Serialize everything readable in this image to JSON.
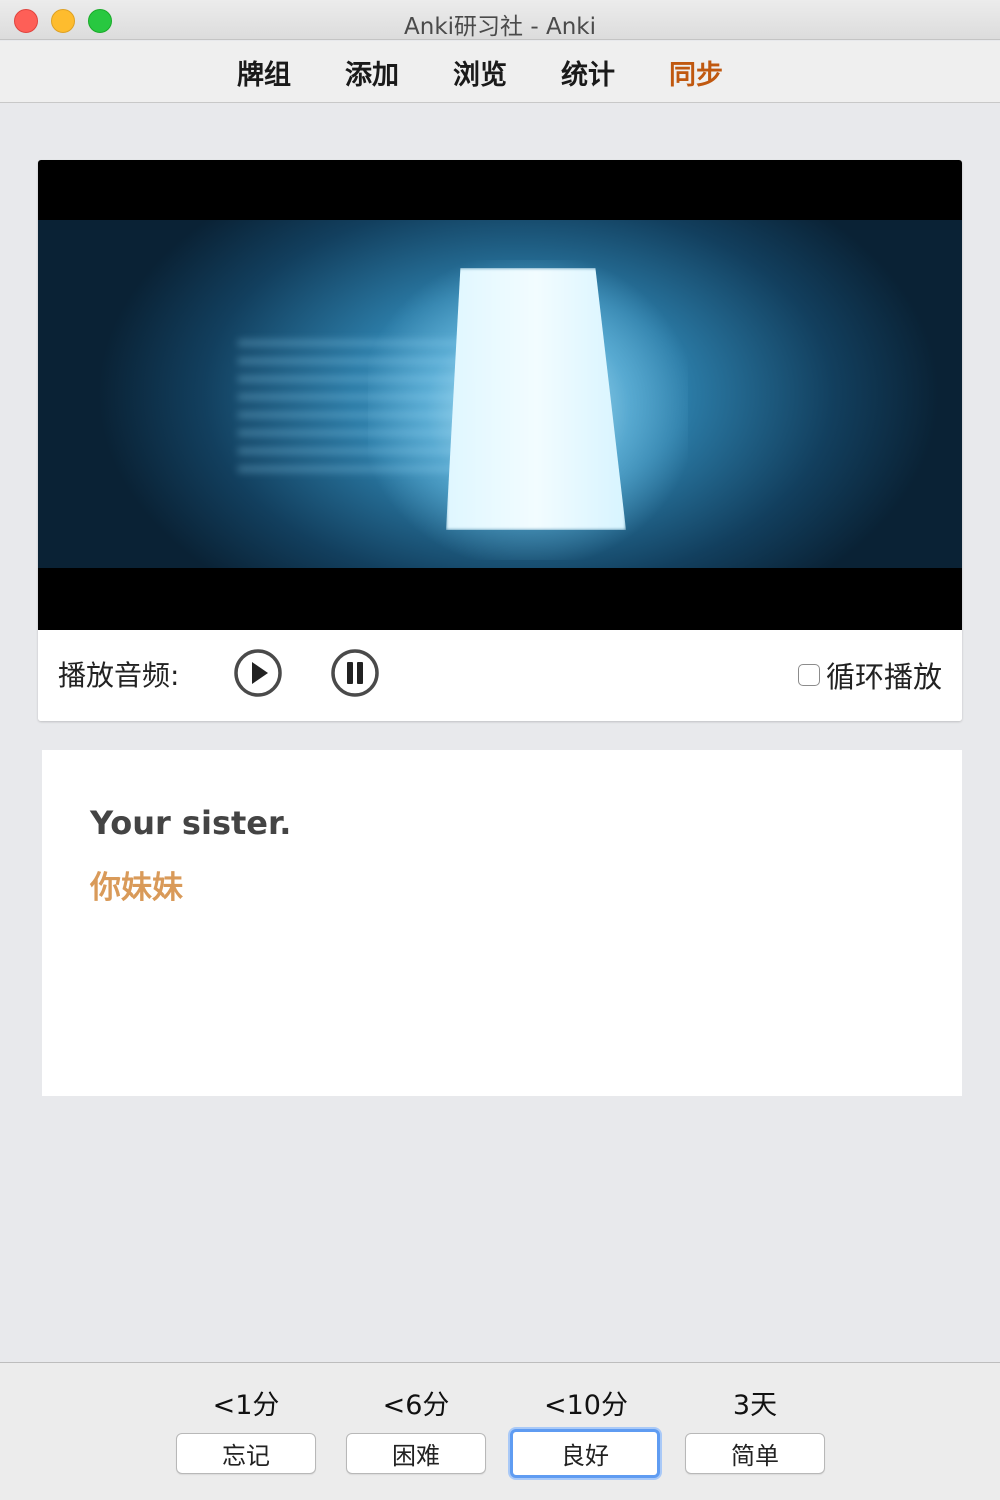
{
  "window": {
    "title": "Anki研习社 - Anki"
  },
  "toolbar": {
    "items": [
      {
        "label": "牌组"
      },
      {
        "label": "添加"
      },
      {
        "label": "浏览"
      },
      {
        "label": "统计"
      },
      {
        "label": "同步"
      }
    ],
    "accent_color": "#c0580f"
  },
  "media": {
    "audio_label": "播放音频:",
    "play_icon": "play-icon",
    "pause_icon": "pause-icon",
    "loop_label": "循环播放",
    "loop_checked": false
  },
  "card": {
    "english": "Your sister.",
    "chinese": "你妹妹",
    "chinese_color": "#d99a59"
  },
  "answers": [
    {
      "interval": "<1分",
      "label": "忘记"
    },
    {
      "interval": "<6分",
      "label": "困难"
    },
    {
      "interval": "<10分",
      "label": "良好",
      "focused": true
    },
    {
      "interval": "3天",
      "label": "简单"
    }
  ]
}
